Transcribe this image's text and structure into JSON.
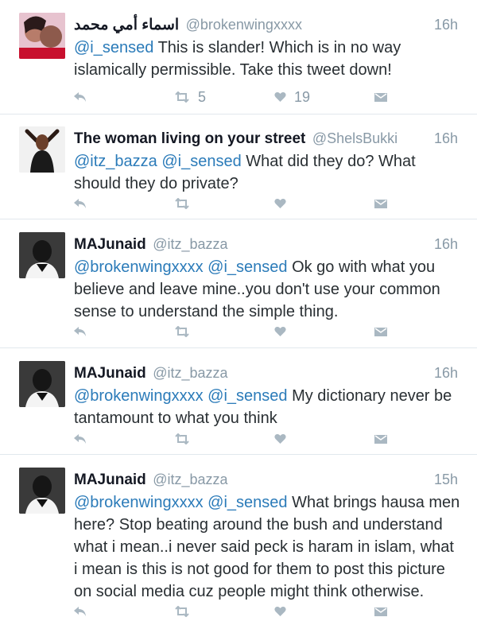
{
  "tweets": [
    {
      "name": "اسماء أمي محمد",
      "handle": "@brokenwingxxxx",
      "time": "16h",
      "mentions": "@i_sensed",
      "body": " This is slander! Which is in no way islamically permissible. Take this tweet down!",
      "retweets": "5",
      "likes": "19"
    },
    {
      "name": "The woman living on your street",
      "handle": "@ShelsBukki",
      "time": "16h",
      "mentions": "@itz_bazza @i_sensed",
      "body": " What did they do? What should they do private?",
      "retweets": "",
      "likes": ""
    },
    {
      "name": "MAJunaid",
      "handle": "@itz_bazza",
      "time": "16h",
      "mentions": "@brokenwingxxxx @i_sensed",
      "body": " Ok go with what you believe and leave mine..you don't use your common sense to understand the simple thing.",
      "retweets": "",
      "likes": ""
    },
    {
      "name": "MAJunaid",
      "handle": "@itz_bazza",
      "time": "16h",
      "mentions": "@brokenwingxxxx @i_sensed",
      "body": " My dictionary never be tantamount to what you think",
      "retweets": "",
      "likes": ""
    },
    {
      "name": "MAJunaid",
      "handle": "@itz_bazza",
      "time": "15h",
      "mentions": "@brokenwingxxxx @i_sensed",
      "body": " What brings hausa men here? Stop beating around the bush and understand what i mean..i never said peck is haram in islam, what i mean is this is not good for them to post this picture on social media cuz people might think otherwise.",
      "retweets": "",
      "likes": ""
    }
  ],
  "icons": {
    "reply": "reply-icon",
    "retweet": "retweet-icon",
    "like": "heart-icon",
    "dm": "direct-message-icon"
  },
  "colors": {
    "mention": "#2b7bb9",
    "secondary": "#8899a6",
    "action_icon": "#aab8c2",
    "divider": "#e1e8ed"
  }
}
